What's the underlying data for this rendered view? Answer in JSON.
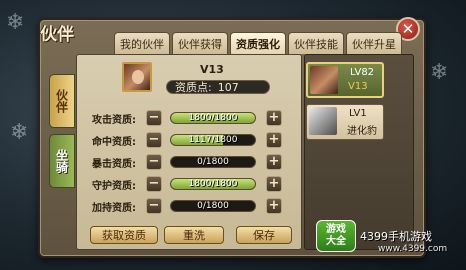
{
  "window": {
    "title": "伙伴",
    "close_symbol": "✕"
  },
  "tabs": [
    {
      "label": "我的伙伴",
      "active": false
    },
    {
      "label": "伙伴获得",
      "active": false
    },
    {
      "label": "资质强化",
      "active": true
    },
    {
      "label": "伙伴技能",
      "active": false
    },
    {
      "label": "伙伴升星",
      "active": false
    }
  ],
  "side_tabs": [
    {
      "label": "伙伴",
      "active": true
    },
    {
      "label": "坐骑",
      "active": false
    }
  ],
  "companion": {
    "level": "V13",
    "aptitude_label": "资质点:",
    "aptitude_value": "107"
  },
  "attributes": [
    {
      "label": "攻击资质:",
      "value": "1800/1800",
      "fill": 1.0
    },
    {
      "label": "命中资质:",
      "value": "1117/1800",
      "fill": 0.62
    },
    {
      "label": "暴击资质:",
      "value": "0/1800",
      "fill": 0.0
    },
    {
      "label": "守护资质:",
      "value": "1800/1800",
      "fill": 1.0
    },
    {
      "label": "加持资质:",
      "value": "0/1800",
      "fill": 0.0
    }
  ],
  "controls": {
    "minus": "−",
    "plus": "+"
  },
  "buttons": {
    "acquire": "获取资质",
    "reset": "重洗",
    "save": "保存"
  },
  "companion_list": [
    {
      "level": "LV82",
      "sub": "V13",
      "selected": true
    },
    {
      "level": "LV1",
      "sub": "进化豹",
      "selected": false
    }
  ],
  "watermark": {
    "badge_line1": "游戏",
    "badge_line2": "大全",
    "site": "4399手机游戏",
    "url": "www.4399.com"
  },
  "colors": {
    "accent_gold": "#c9a25a",
    "bar_green": "#9cc44a",
    "selected_sub": "#f2c94c"
  }
}
